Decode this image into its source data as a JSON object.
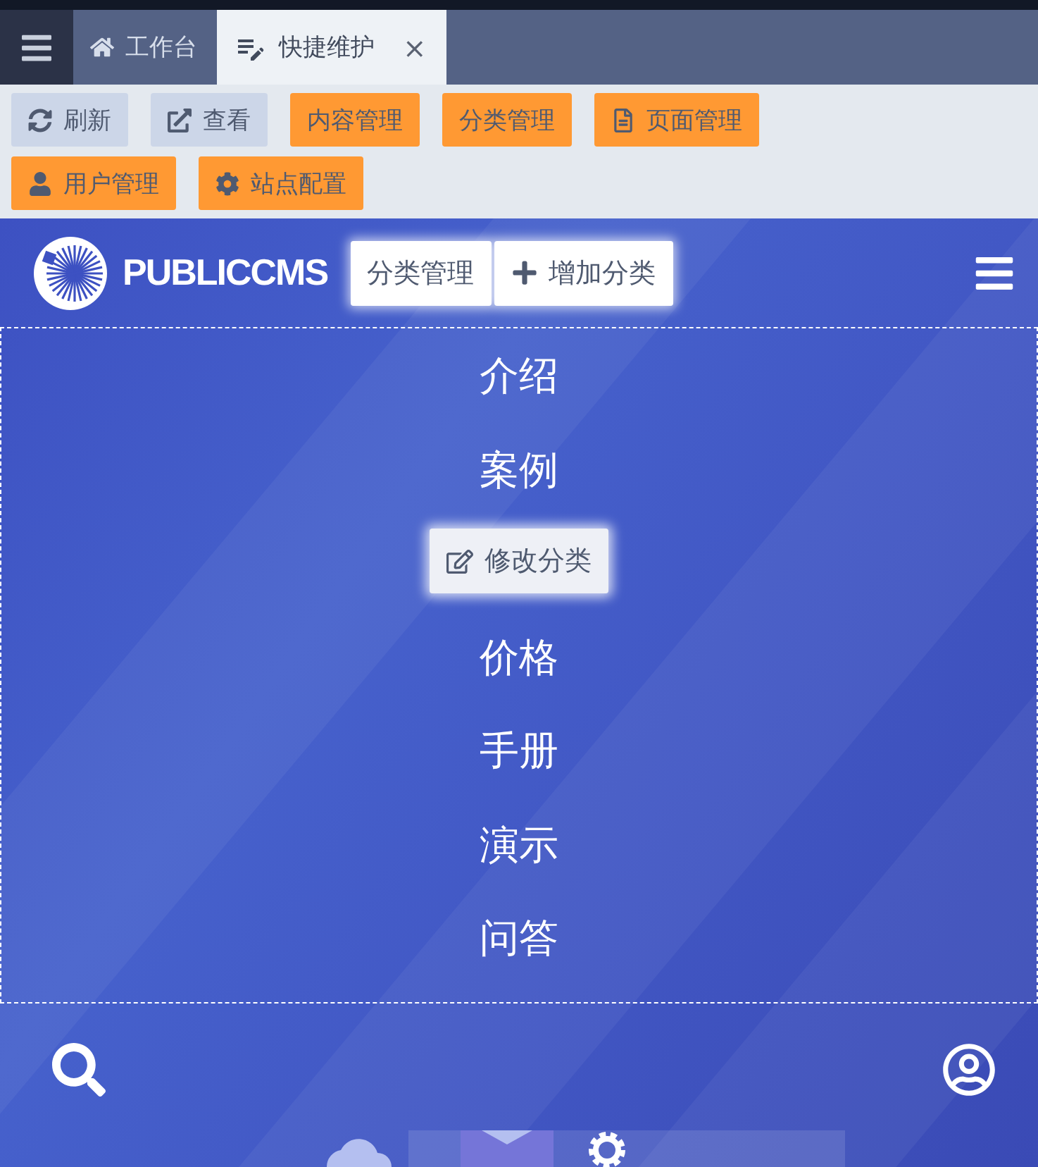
{
  "tabs": [
    {
      "label": "工作台",
      "selected": false
    },
    {
      "label": "快捷维护",
      "selected": true,
      "close": "×"
    }
  ],
  "toolbar": [
    {
      "label": "刷新",
      "kind": "plain"
    },
    {
      "label": "查看",
      "kind": "plain"
    },
    {
      "label": "内容管理",
      "kind": "accent"
    },
    {
      "label": "分类管理",
      "kind": "accent"
    },
    {
      "label": "页面管理",
      "kind": "accent"
    },
    {
      "label": "用户管理",
      "kind": "accent"
    },
    {
      "label": "站点配置",
      "kind": "accent"
    }
  ],
  "site": {
    "logo": "PUBLICCMS",
    "edit_buttons": [
      {
        "label": "分类管理"
      },
      {
        "label": "增加分类"
      }
    ],
    "nav": [
      {
        "label": "介绍",
        "kind": "link"
      },
      {
        "label": "案例",
        "kind": "link"
      },
      {
        "label": "修改分类",
        "kind": "edit"
      },
      {
        "label": "价格",
        "kind": "link"
      },
      {
        "label": "手册",
        "kind": "link"
      },
      {
        "label": "演示",
        "kind": "link"
      },
      {
        "label": "问答",
        "kind": "link"
      }
    ]
  }
}
